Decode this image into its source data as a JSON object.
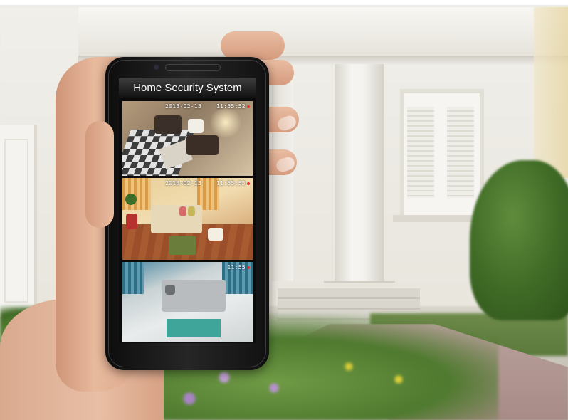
{
  "app": {
    "title": "Home Security System"
  },
  "feeds": [
    {
      "date": "2018-02-13",
      "time": "11:55:52"
    },
    {
      "date": "2018-02-13",
      "time": "11:55:53"
    },
    {
      "date": "",
      "time": "11:55"
    }
  ],
  "colors": {
    "title_bar": "#111111",
    "title_text": "#ffffff",
    "phone_body": "#1a1a1a",
    "rec_indicator": "#e03030"
  },
  "icons": {
    "speaker": "earpiece-speaker-icon",
    "camera": "front-camera-icon",
    "recording": "recording-dot-icon"
  }
}
